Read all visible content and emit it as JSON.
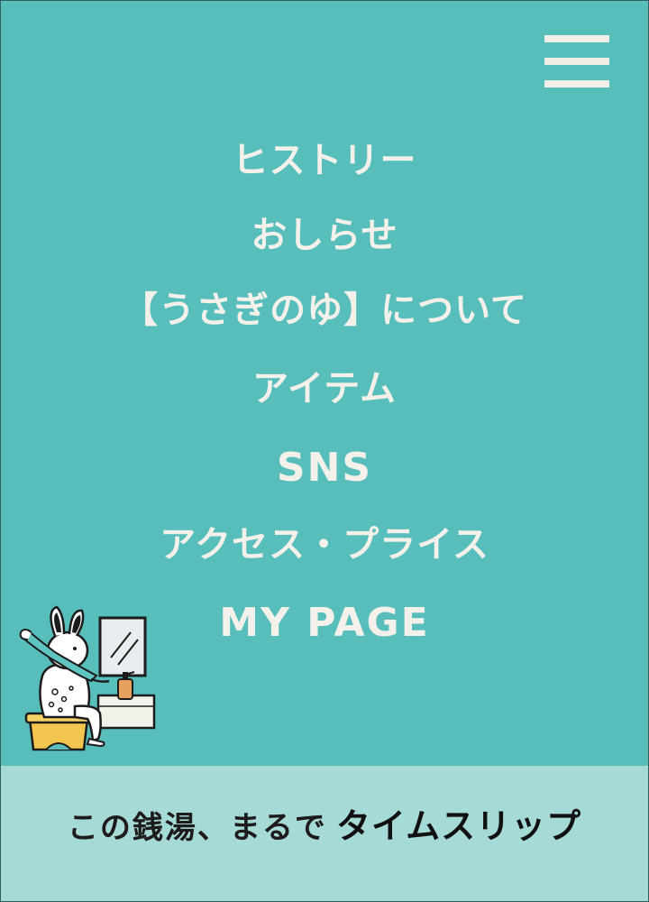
{
  "menu_button": {
    "icon": "hamburger-menu-icon"
  },
  "nav": {
    "items": [
      {
        "label": "ヒストリー"
      },
      {
        "label": "おしらせ"
      },
      {
        "label": "【うさぎのゆ】について"
      },
      {
        "label": "アイテム"
      },
      {
        "label": "SNS"
      },
      {
        "label": "アクセス・プライス"
      },
      {
        "label": "MY PAGE"
      }
    ]
  },
  "footer": {
    "tagline_part1": "この銭湯、まるで",
    "tagline_part2": "タイムスリップ"
  },
  "colors": {
    "panel": "#58bebc",
    "footer": "#a6dad6",
    "menu_text": "#f4f1ea",
    "tagline_text": "#111111"
  }
}
